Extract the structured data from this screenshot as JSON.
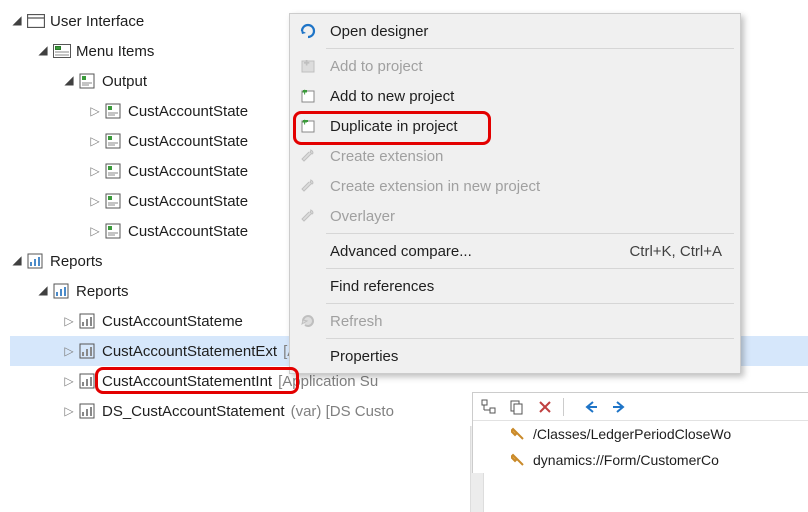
{
  "tree": {
    "ui": "User Interface",
    "menuItems": "Menu Items",
    "output": "Output",
    "outputChildren": [
      "CustAccountState",
      "CustAccountState",
      "CustAccountState",
      "CustAccountState",
      "CustAccountState"
    ],
    "reports1": "Reports",
    "reports2": "Reports",
    "reportChildren": [
      {
        "name": "CustAccountStateme",
        "suffix": ""
      },
      {
        "name": "CustAccountStatementExt",
        "suffix": "[Application Su"
      },
      {
        "name": "CustAccountStatementInt",
        "suffix": "[Application Su"
      },
      {
        "name": "DS_CustAccountStatement",
        "suffix": "(var) [DS Custo"
      }
    ]
  },
  "menu": {
    "openDesigner": "Open designer",
    "addToProject": "Add to project",
    "addToNewProject": "Add to new project",
    "duplicateInProject": "Duplicate in project",
    "createExtension": "Create extension",
    "createExtensionNew": "Create extension in new project",
    "overlayer": "Overlayer",
    "advancedCompare": "Advanced compare...",
    "advancedCompareShortcut": "Ctrl+K, Ctrl+A",
    "findReferences": "Find references",
    "refresh": "Refresh",
    "properties": "Properties"
  },
  "rightPanel": {
    "item1": "/Classes/LedgerPeriodCloseWo",
    "item2": "dynamics://Form/CustomerCo"
  }
}
